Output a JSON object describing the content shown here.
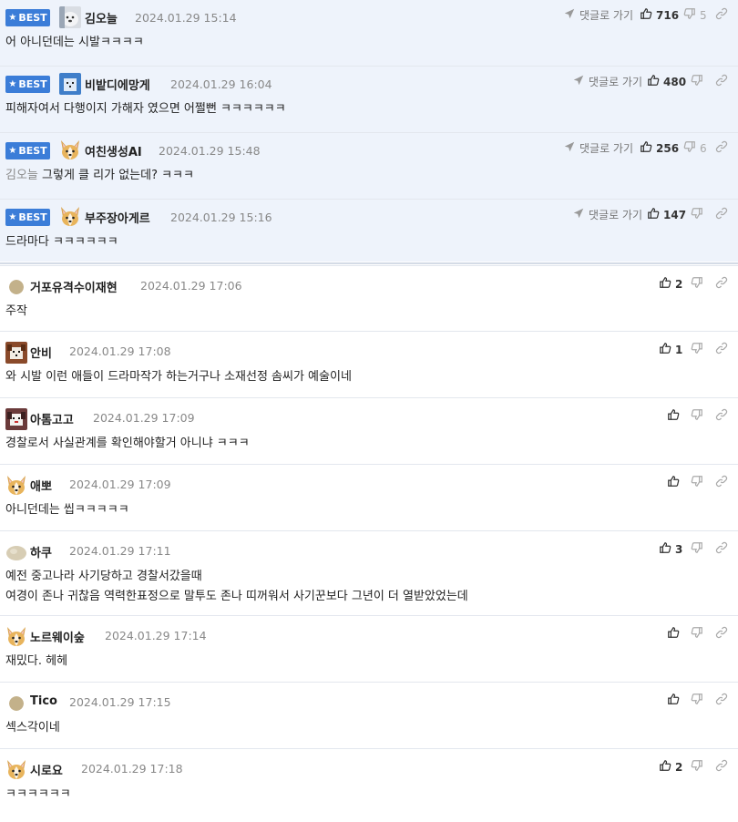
{
  "best_label": "BEST",
  "goto_label": "댓글로 가기",
  "colors": {
    "accent": "#3b7dd8",
    "best_bg": "#eef3fb",
    "date": "#888888",
    "mention": "#8a8a8a"
  },
  "best_comments": [
    {
      "nickname": "김오늘",
      "date": "2024.01.29 15:14",
      "text": "어 아니던데는 시발ㅋㅋㅋㅋ",
      "likes": "716",
      "dislikes": "5",
      "avatar": "dog-photo"
    },
    {
      "nickname": "비밭디에망게",
      "date": "2024.01.29 16:04",
      "text": "피해자여서 다행이지 가해자 였으면 어쩔뻔 ㅋㅋㅋㅋㅋㅋ",
      "likes": "480",
      "dislikes": "",
      "avatar": "blue-pixel-dog"
    },
    {
      "nickname": "여친생성AI",
      "date": "2024.01.29 15:48",
      "mention": "김오늘",
      "text": "그렇게 클 리가 없는데? ㅋㅋㅋ",
      "likes": "256",
      "dislikes": "6",
      "avatar": "corgi"
    },
    {
      "nickname": "부주장아게르",
      "date": "2024.01.29 15:16",
      "text": "드라마다 ㅋㅋㅋㅋㅋㅋ",
      "likes": "147",
      "dislikes": "",
      "avatar": "corgi"
    }
  ],
  "comments": [
    {
      "nickname": "거포유격수이재현",
      "date": "2024.01.29 17:06",
      "lines": [
        "주작"
      ],
      "likes": "2",
      "avatar": "dot-tan"
    },
    {
      "nickname": "안비",
      "date": "2024.01.29 17:08",
      "lines": [
        "와 시발 이런 애들이 드라마작가 하는거구나 소재선정 솜씨가 예술이네"
      ],
      "likes": "1",
      "avatar": "pixel-dog"
    },
    {
      "nickname": "아톰고고",
      "date": "2024.01.29 17:09",
      "lines": [
        "경찰로서 사실관계를 확인해야할거 아니냐 ㅋㅋㅋ"
      ],
      "likes": "",
      "avatar": "pixel-dog-red"
    },
    {
      "nickname": "애뽀",
      "date": "2024.01.29 17:09",
      "lines": [
        "아니던데는 씹ㅋㅋㅋㅋㅋ"
      ],
      "likes": "",
      "avatar": "corgi"
    },
    {
      "nickname": "하쿠",
      "date": "2024.01.29 17:11",
      "lines": [
        "예전 중고나라 사기당하고 경찰서갔을때",
        "여경이 존나 귀찮음 역력한표정으로 말투도 존나 띠꺼워서 사기꾼보다 그년이 더 열받았었는데"
      ],
      "likes": "3",
      "avatar": "blob"
    },
    {
      "nickname": "노르웨이숲",
      "date": "2024.01.29 17:14",
      "lines": [
        "재밌다. 헤헤"
      ],
      "likes": "",
      "avatar": "corgi"
    },
    {
      "nickname": "Tico",
      "date": "2024.01.29 17:15",
      "lines": [
        "섹스각이네"
      ],
      "likes": "",
      "avatar": "dot-tan"
    },
    {
      "nickname": "시로요",
      "date": "2024.01.29 17:18",
      "lines": [
        "ㅋㅋㅋㅋㅋㅋ"
      ],
      "likes": "2",
      "avatar": "corgi"
    }
  ]
}
